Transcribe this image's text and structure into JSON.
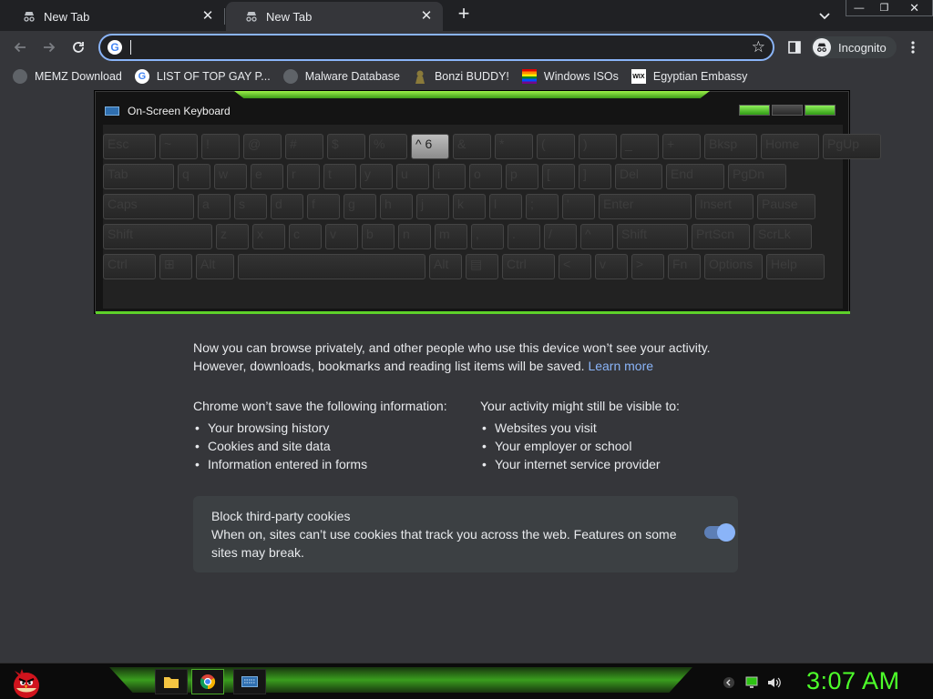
{
  "tabs": [
    {
      "title": "New Tab"
    },
    {
      "title": "New Tab"
    }
  ],
  "window_controls": {
    "minimize": "—",
    "maximize": "❐",
    "close": "✕"
  },
  "omnibox": {
    "value": "",
    "placeholder": ""
  },
  "profile": {
    "label": "Incognito"
  },
  "bookmarks": [
    {
      "label": "MEMZ Download",
      "icon": "globe-icon"
    },
    {
      "label": "LIST OF TOP GAY P...",
      "icon": "google-icon"
    },
    {
      "label": "Malware Database",
      "icon": "globe-icon"
    },
    {
      "label": "Bonzi BUDDY!",
      "icon": "bonzi-icon"
    },
    {
      "label": "Windows ISOs",
      "icon": "rainbow-flag-icon"
    },
    {
      "label": "Egyptian Embassy",
      "icon": "wix-icon"
    }
  ],
  "osk": {
    "title": "On-Screen Keyboard",
    "rows": [
      [
        "Esc",
        "~",
        "!",
        "@",
        "#",
        "$",
        "%",
        "^ 6",
        "&",
        "*",
        "(",
        ")",
        "_",
        "+",
        "Bksp",
        "Home",
        "PgUp"
      ],
      [
        "Tab",
        "q",
        "w",
        "e",
        "r",
        "t",
        "y",
        "u",
        "i",
        "o",
        "p",
        "[",
        "]",
        "Del",
        "End",
        "PgDn"
      ],
      [
        "Caps",
        "a",
        "s",
        "d",
        "f",
        "g",
        "h",
        "j",
        "k",
        "l",
        ";",
        "'",
        "Enter",
        "Insert",
        "Pause"
      ],
      [
        "Shift",
        "z",
        "x",
        "c",
        "v",
        "b",
        "n",
        "m",
        ",",
        ".",
        "/",
        "^",
        "Shift",
        "PrtScn",
        "ScrLk"
      ],
      [
        "Ctrl",
        "⊞",
        "Alt",
        "",
        "Alt",
        "▤",
        "Ctrl",
        "<",
        "v",
        ">",
        "Fn",
        "Options",
        "Help"
      ]
    ]
  },
  "incognito_page": {
    "intro_line1": "Now you can browse privately, and other people who use this device won’t see your activity.",
    "intro_line2": "However, downloads, bookmarks and reading list items will be saved.",
    "learn_more": "Learn more",
    "wont_save_heading": "Chrome won’t save the following information:",
    "wont_save_items": [
      "Your browsing history",
      "Cookies and site data",
      "Information entered in forms"
    ],
    "visible_heading": "Your activity might still be visible to:",
    "visible_items": [
      "Websites you visit",
      "Your employer or school",
      "Your internet service provider"
    ],
    "cookie_title": "Block third-party cookies",
    "cookie_desc": "When on, sites can’t use cookies that track you across the web. Features on some sites may break.",
    "cookie_toggle_on": true
  },
  "taskbar": {
    "clock": "3:07 AM",
    "apps": [
      "folder-icon",
      "chrome-icon",
      "keyboard-icon"
    ],
    "accent": "#4dff2a"
  },
  "colors": {
    "link": "#8ab4f8",
    "page_bg": "#35363a",
    "tabstrip_bg": "#202124"
  }
}
